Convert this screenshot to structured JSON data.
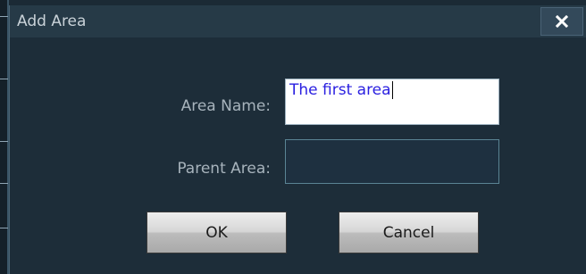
{
  "dialog": {
    "title": "Add Area",
    "close_icon": "close-x-icon"
  },
  "form": {
    "area_name_label": "Area Name:",
    "area_name_value": "The first area",
    "parent_area_label": "Parent Area:",
    "parent_area_value": ""
  },
  "buttons": {
    "ok_label": "OK",
    "cancel_label": "Cancel"
  },
  "colors": {
    "dialog_background": "#1d2d39",
    "titlebar": "#263a47",
    "input_text": "#2a1fe0",
    "button_gradient_top": "#eeeeee",
    "button_gradient_bottom": "#a9a9a9"
  }
}
